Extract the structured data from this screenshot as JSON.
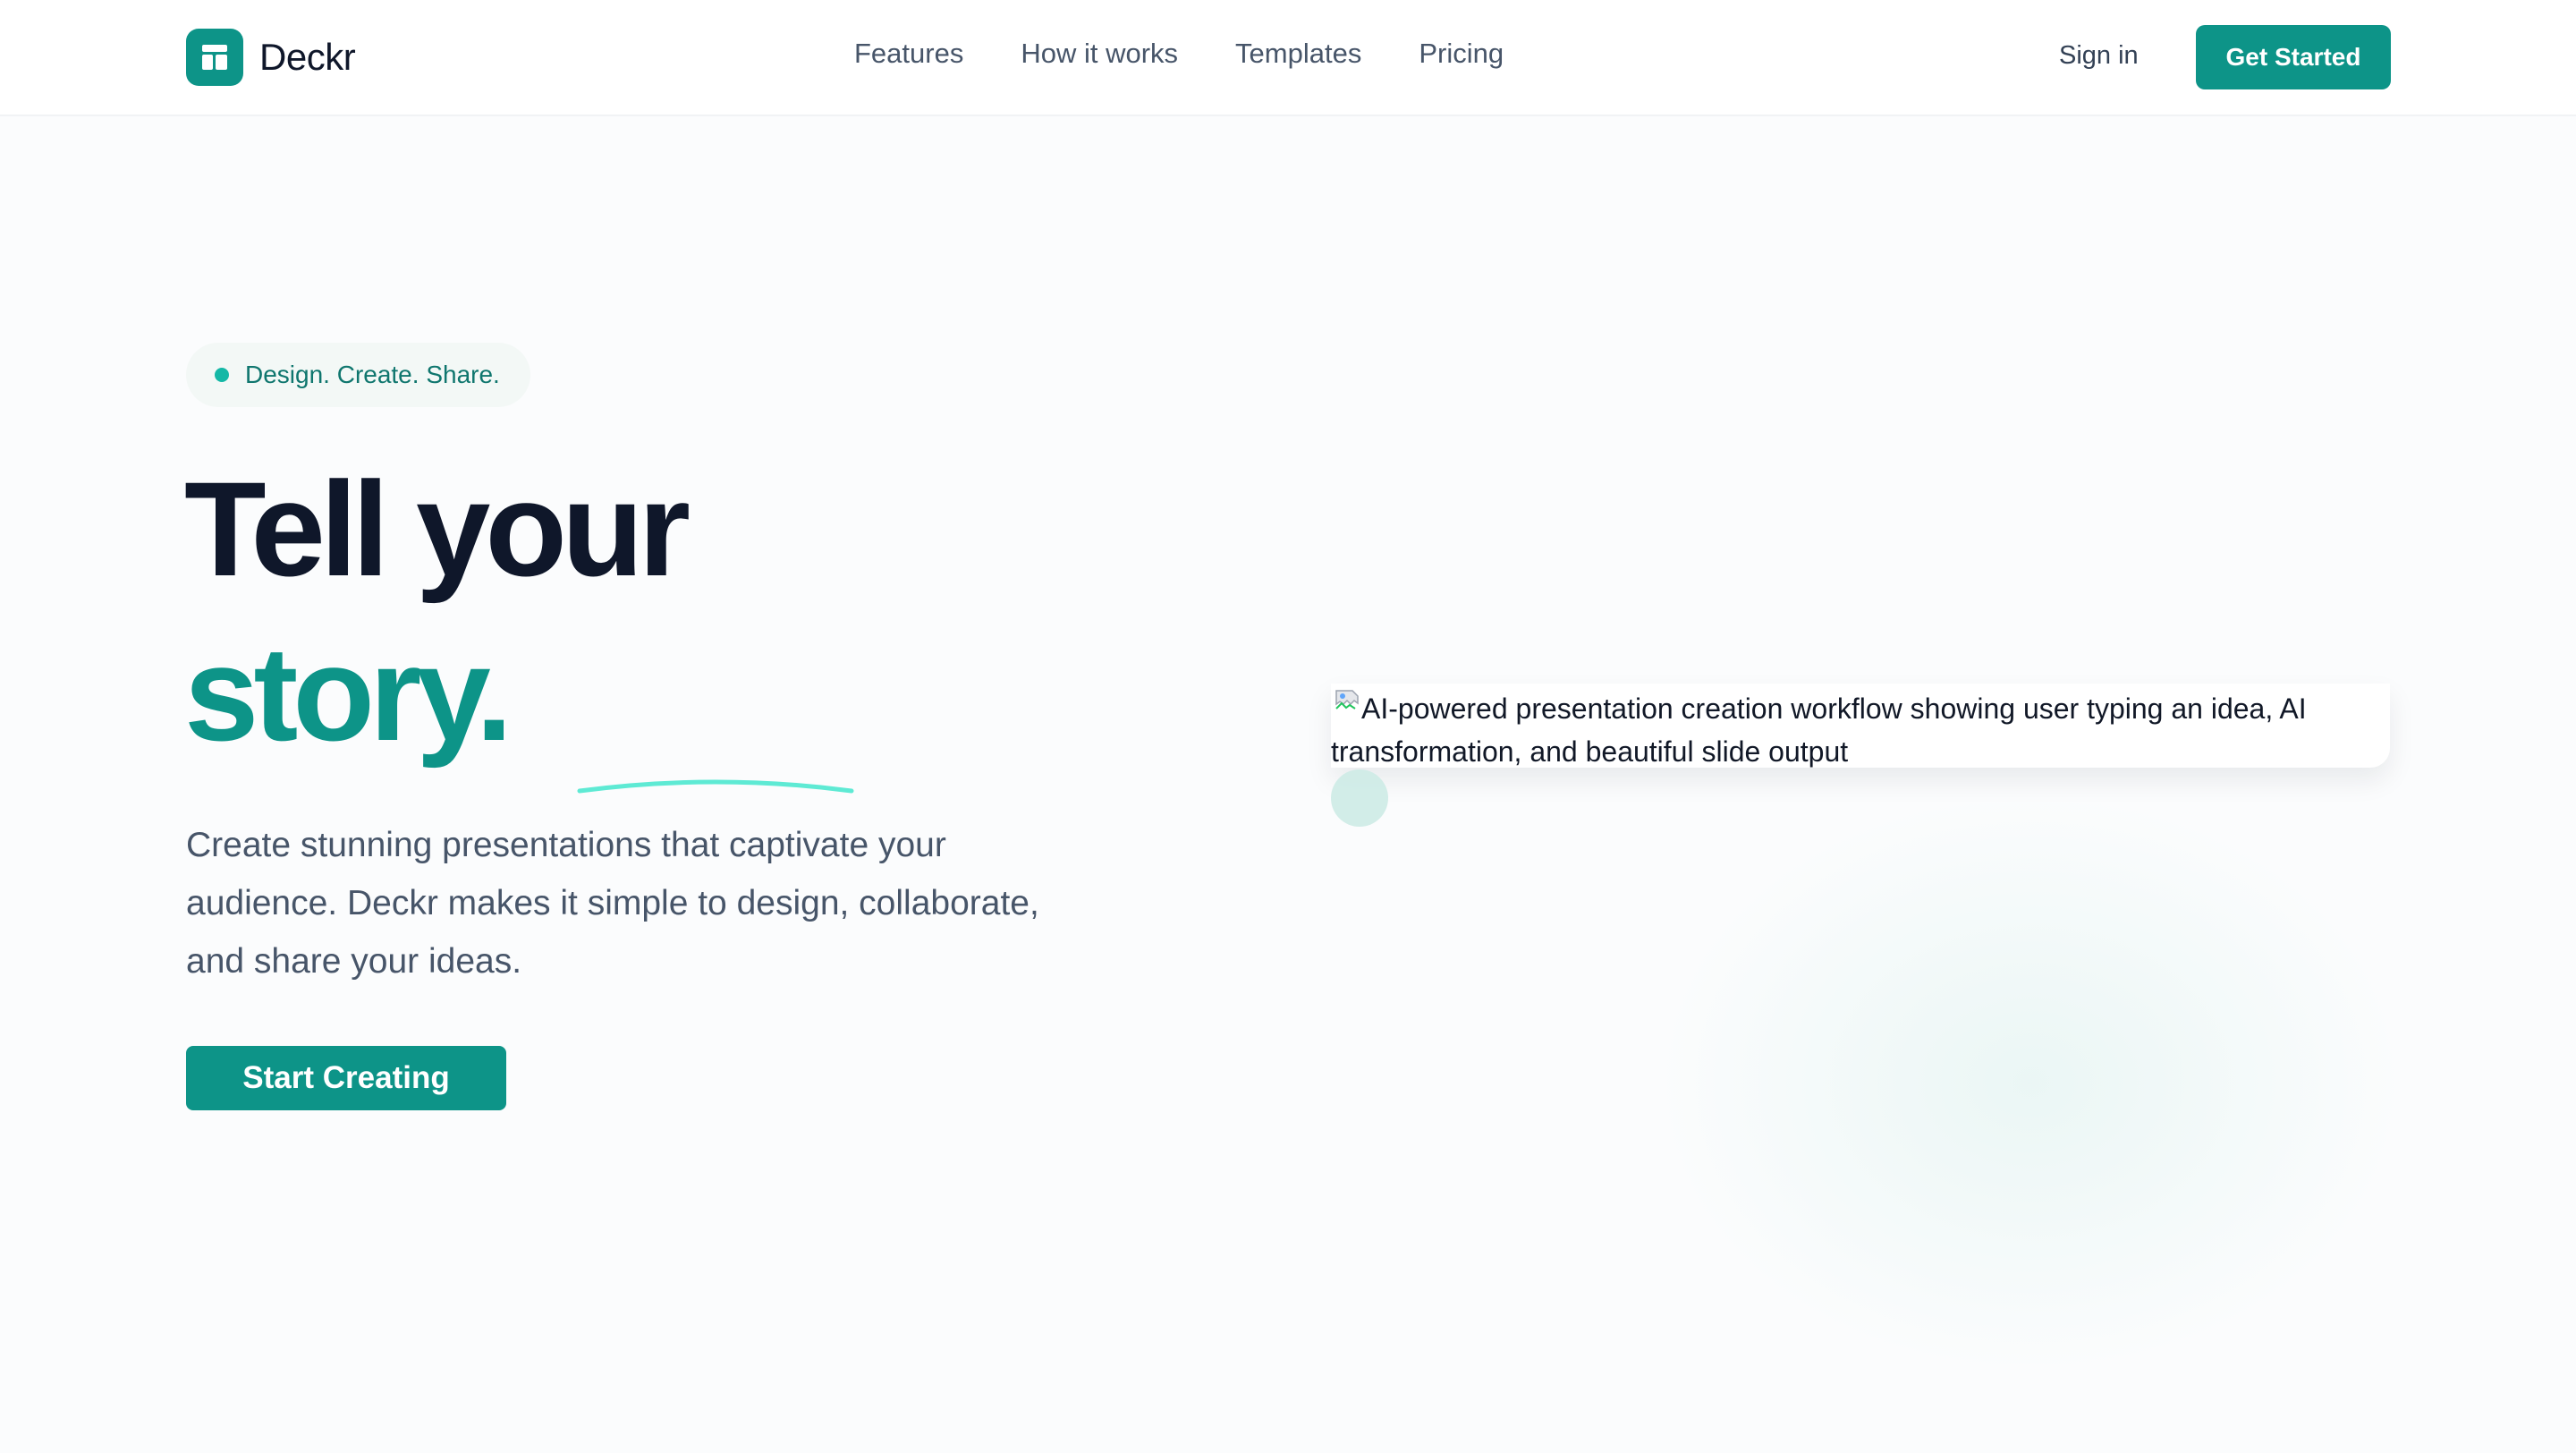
{
  "brand": {
    "name": "Deckr",
    "logo_icon": "layout-icon",
    "accent": "#0d9488"
  },
  "nav": {
    "items": [
      "Features",
      "How it works",
      "Templates",
      "Pricing"
    ]
  },
  "header": {
    "signin_label": "Sign in",
    "cta_label": "Get Started"
  },
  "hero": {
    "tag": "Design. Create. Share.",
    "headline_line1": "Tell your",
    "headline_line2": "story.",
    "subtitle": "Create stunning presentations that captivate your audience. Deckr makes it simple to design, collaborate, and share your ideas.",
    "primary_cta": "Start Creating"
  },
  "illustration": {
    "alt_text": "AI-powered presentation creation workflow showing user typing an idea, AI transformation, and beautiful slide output",
    "icon": "broken-image-icon"
  }
}
